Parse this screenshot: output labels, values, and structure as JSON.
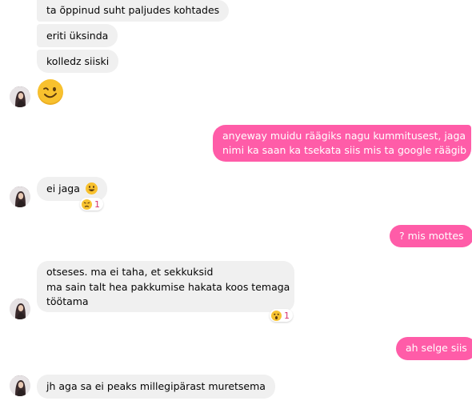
{
  "conversation": {
    "messages": [
      {
        "id": "m1",
        "text": "ta õppinud suht paljudes kohtades"
      },
      {
        "id": "m2",
        "text": "eriti üksinda"
      },
      {
        "id": "m3",
        "text": "kolledz siiski"
      },
      {
        "id": "m4",
        "emoji": "winking-face"
      },
      {
        "id": "m5",
        "line1": "anyeway muidu räägiks nagu kummitusest, jaga",
        "line2": "nimi ka saan ka tsekata siis mis ta google räägib"
      },
      {
        "id": "m6",
        "text": "ei jaga",
        "emoji": "grinning-face",
        "reaction": {
          "emoji": "confused-face",
          "count": "1"
        }
      },
      {
        "id": "m7",
        "text": "? mis mottes"
      },
      {
        "id": "m8",
        "line1": "otseses. ma ei taha, et sekkuksid",
        "line2": "ma sain talt hea pakkumise hakata koos temaga",
        "line3": "töötama",
        "reaction": {
          "emoji": "surprised-face",
          "count": "1"
        }
      },
      {
        "id": "m9",
        "text": "ah selge siis"
      },
      {
        "id": "m10",
        "text": "jh aga sa ei peaks millegipärast muretsema"
      }
    ]
  },
  "colors": {
    "outgoing": "#ff5ca8",
    "incoming": "#f0f0f0",
    "reaction_count": "#d6336c"
  }
}
